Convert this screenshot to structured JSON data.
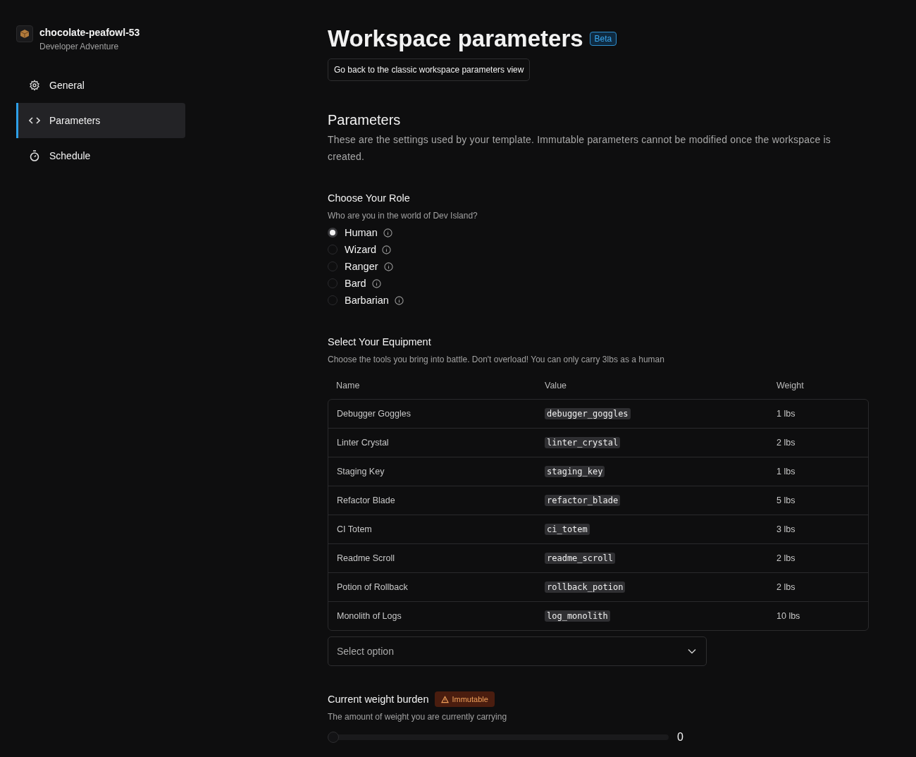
{
  "workspace": {
    "name": "chocolate-peafowl-53",
    "template": "Developer Adventure"
  },
  "sidebar": {
    "items": [
      {
        "label": "General",
        "kind": "settings",
        "selected": false
      },
      {
        "label": "Parameters",
        "kind": "code",
        "selected": true
      },
      {
        "label": "Schedule",
        "kind": "schedule",
        "selected": false
      }
    ]
  },
  "page": {
    "title": "Workspace parameters",
    "badge": "Beta",
    "classic_button": "Go back to the classic workspace parameters view"
  },
  "section": {
    "title": "Parameters",
    "description": "These are the settings used by your template. Immutable parameters cannot be modified once the workspace is created."
  },
  "parameters": [
    {
      "kind": "radio",
      "label": "Choose Your Role",
      "description": "Who are you in the world of Dev Island?",
      "options": [
        {
          "label": "Human",
          "selected": true
        },
        {
          "label": "Wizard",
          "selected": false
        },
        {
          "label": "Ranger",
          "selected": false
        },
        {
          "label": "Bard",
          "selected": false
        },
        {
          "label": "Barbarian",
          "selected": false
        }
      ]
    },
    {
      "kind": "multiselect",
      "label": "Select Your Equipment",
      "description": "Choose the tools you bring into battle. Don't overload! You can only carry 3lbs as a human",
      "columns": [
        "Name",
        "Value",
        "Weight"
      ],
      "rows": [
        [
          "Debugger Goggles",
          "debugger_goggles",
          "1 lbs"
        ],
        [
          "Linter Crystal",
          "linter_crystal",
          "2 lbs"
        ],
        [
          "Staging Key",
          "staging_key",
          "1 lbs"
        ],
        [
          "Refactor Blade",
          "refactor_blade",
          "5 lbs"
        ],
        [
          "CI Totem",
          "ci_totem",
          "3 lbs"
        ],
        [
          "Readme Scroll",
          "readme_scroll",
          "2 lbs"
        ],
        [
          "Potion of Rollback",
          "rollback_potion",
          "2 lbs"
        ],
        [
          "Monolith of Logs",
          "log_monolith",
          "10 lbs"
        ]
      ],
      "placeholder": "Select option"
    },
    {
      "kind": "slider",
      "label": "Current weight burden",
      "tag": "Immutable",
      "description": "The amount of weight you are currently carrying",
      "level": 0,
      "reading": "0"
    }
  ]
}
